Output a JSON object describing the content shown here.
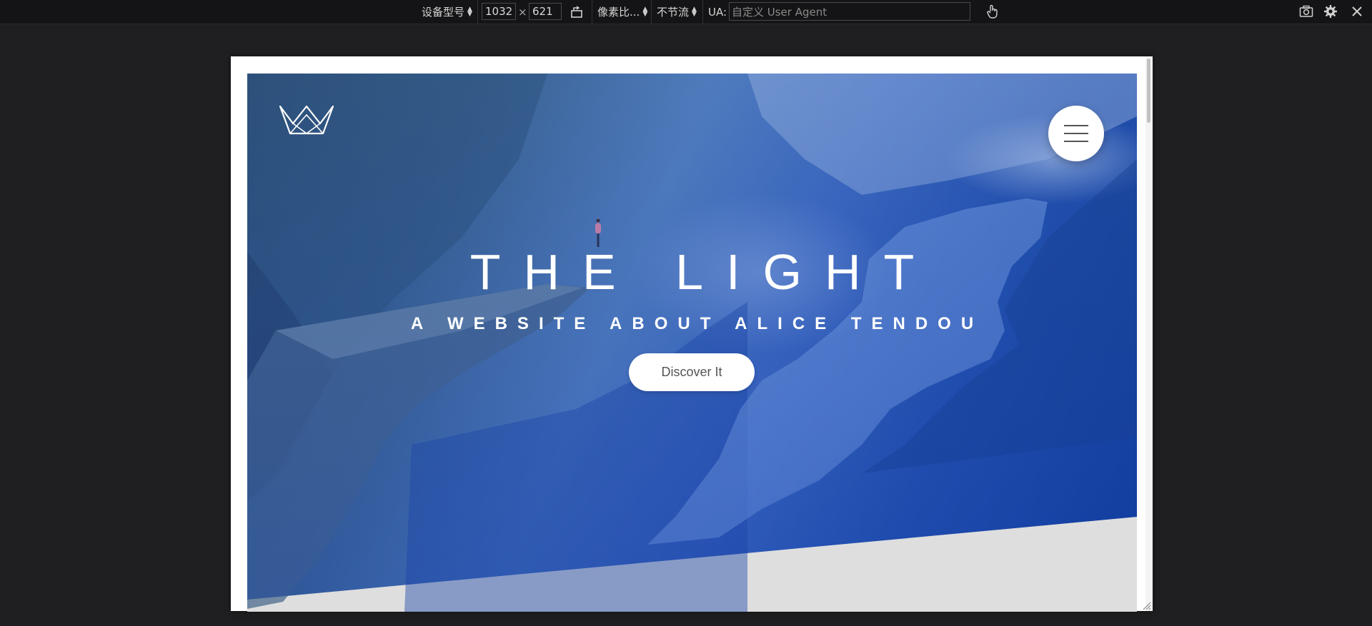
{
  "devtools": {
    "device_model": "设备型号",
    "width": "1032",
    "times": "×",
    "height": "621",
    "pixel_ratio": "像素比...",
    "throttle": "不节流",
    "ua_label": "UA:",
    "ua_placeholder": "自定义 User Agent",
    "icons": [
      "rotate-icon",
      "touch-icon",
      "screenshot-icon",
      "settings-icon",
      "close-icon"
    ]
  },
  "page": {
    "title": "THE LIGHT",
    "subtitle": "A WEBSITE ABOUT ALICE TENDOU",
    "cta_label": "Discover It",
    "icons": [
      "crown-logo-icon",
      "hamburger-menu-icon"
    ]
  },
  "colors": {
    "toolbar_bg": "#141416",
    "hero_blue": "#2352b0",
    "footer_grey": "#dedede"
  }
}
